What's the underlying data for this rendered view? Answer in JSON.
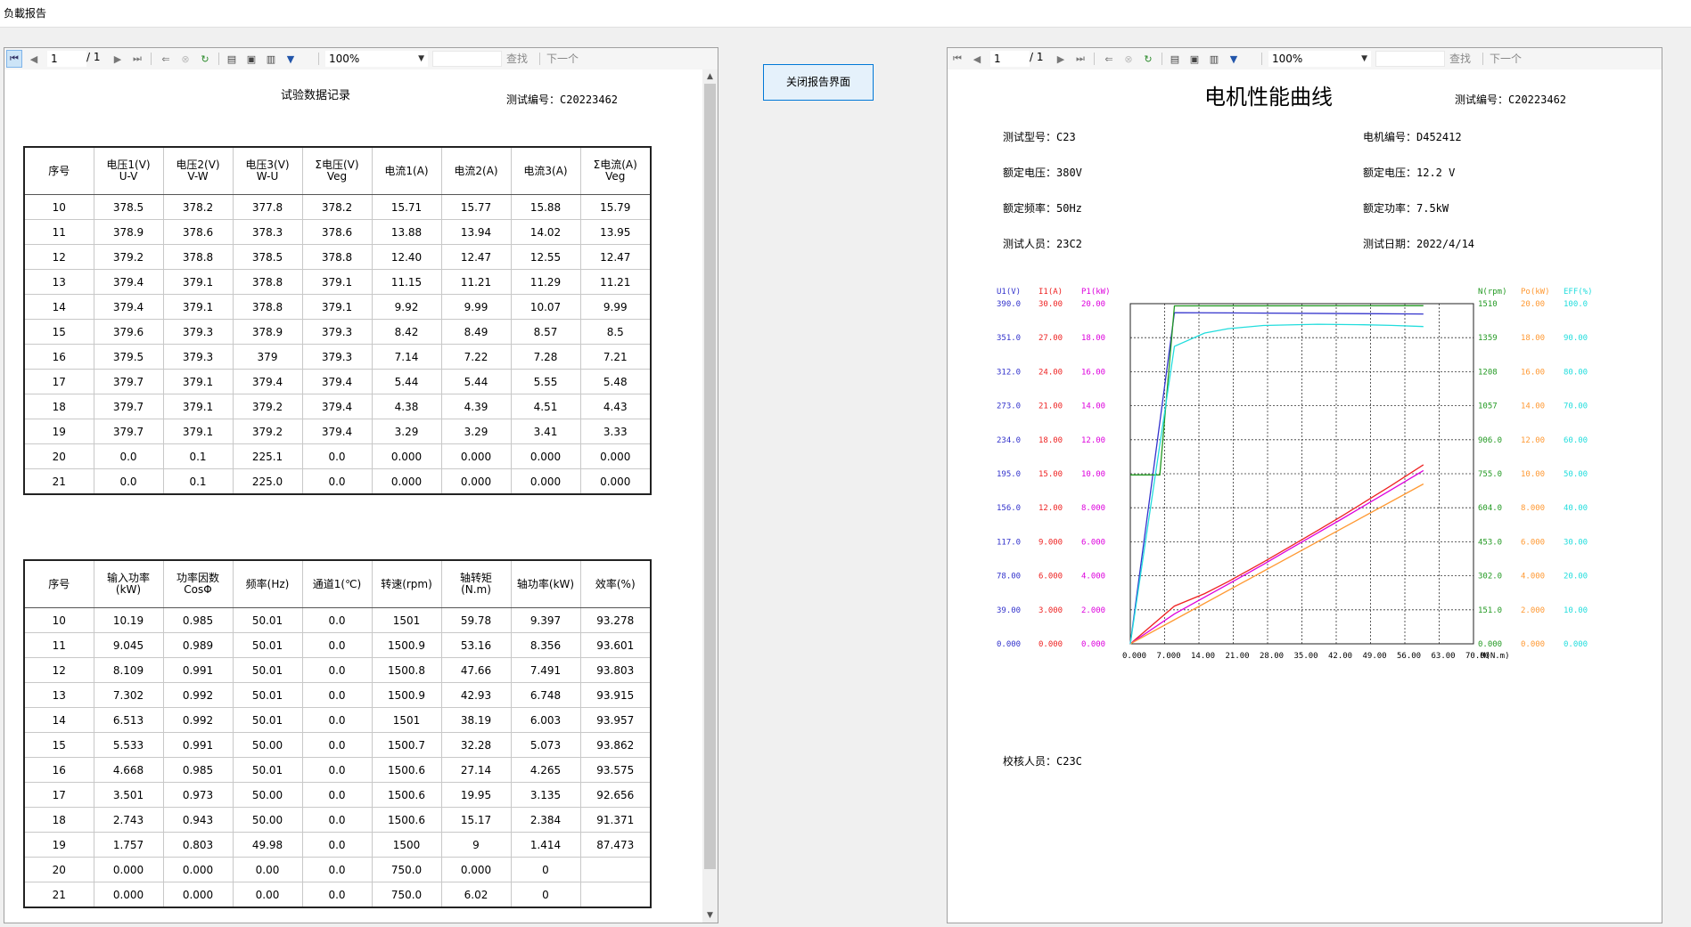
{
  "window": {
    "title": "负載报告"
  },
  "toolbar": {
    "page_current": "1",
    "page_total": "/ 1",
    "zoom": "100%",
    "find_label": "查找",
    "next_label": "下一个"
  },
  "close_button": "关闭报告界面",
  "left_report": {
    "title": "试验数据记录",
    "test_no": "测试编号：C20223462",
    "table1": {
      "headers": [
        [
          "序号",
          ""
        ],
        [
          "电压1(V)",
          "U-V"
        ],
        [
          "电压2(V)",
          "V-W"
        ],
        [
          "电压3(V)",
          "W-U"
        ],
        [
          "Σ电压(V)",
          "Veg"
        ],
        [
          "电流1(A)",
          ""
        ],
        [
          "电流2(A)",
          ""
        ],
        [
          "电流3(A)",
          ""
        ],
        [
          "Σ电流(A)",
          "Veg"
        ]
      ],
      "rows": [
        [
          "10",
          "378.5",
          "378.2",
          "377.8",
          "378.2",
          "15.71",
          "15.77",
          "15.88",
          "15.79"
        ],
        [
          "11",
          "378.9",
          "378.6",
          "378.3",
          "378.6",
          "13.88",
          "13.94",
          "14.02",
          "13.95"
        ],
        [
          "12",
          "379.2",
          "378.8",
          "378.5",
          "378.8",
          "12.40",
          "12.47",
          "12.55",
          "12.47"
        ],
        [
          "13",
          "379.4",
          "379.1",
          "378.8",
          "379.1",
          "11.15",
          "11.21",
          "11.29",
          "11.21"
        ],
        [
          "14",
          "379.4",
          "379.1",
          "378.8",
          "379.1",
          "9.92",
          "9.99",
          "10.07",
          "9.99"
        ],
        [
          "15",
          "379.6",
          "379.3",
          "378.9",
          "379.3",
          "8.42",
          "8.49",
          "8.57",
          "8.5"
        ],
        [
          "16",
          "379.5",
          "379.3",
          "379",
          "379.3",
          "7.14",
          "7.22",
          "7.28",
          "7.21"
        ],
        [
          "17",
          "379.7",
          "379.1",
          "379.4",
          "379.4",
          "5.44",
          "5.44",
          "5.55",
          "5.48"
        ],
        [
          "18",
          "379.7",
          "379.1",
          "379.2",
          "379.4",
          "4.38",
          "4.39",
          "4.51",
          "4.43"
        ],
        [
          "19",
          "379.7",
          "379.1",
          "379.2",
          "379.4",
          "3.29",
          "3.29",
          "3.41",
          "3.33"
        ],
        [
          "20",
          "0.0",
          "0.1",
          "225.1",
          "0.0",
          "0.000",
          "0.000",
          "0.000",
          "0.000"
        ],
        [
          "21",
          "0.0",
          "0.1",
          "225.0",
          "0.0",
          "0.000",
          "0.000",
          "0.000",
          "0.000"
        ]
      ]
    },
    "table2": {
      "headers": [
        [
          "序号",
          ""
        ],
        [
          "输入功率",
          "(kW)"
        ],
        [
          "功率因数",
          "CosΦ"
        ],
        [
          "频率(Hz)",
          ""
        ],
        [
          "通道1(℃)",
          ""
        ],
        [
          "转速(rpm)",
          ""
        ],
        [
          "轴转矩",
          "(N.m)"
        ],
        [
          "轴功率(kW)",
          ""
        ],
        [
          "效率(%)",
          ""
        ]
      ],
      "rows": [
        [
          "10",
          "10.19",
          "0.985",
          "50.01",
          "0.0",
          "1501",
          "59.78",
          "9.397",
          "93.278"
        ],
        [
          "11",
          "9.045",
          "0.989",
          "50.01",
          "0.0",
          "1500.9",
          "53.16",
          "8.356",
          "93.601"
        ],
        [
          "12",
          "8.109",
          "0.991",
          "50.01",
          "0.0",
          "1500.8",
          "47.66",
          "7.491",
          "93.803"
        ],
        [
          "13",
          "7.302",
          "0.992",
          "50.01",
          "0.0",
          "1500.9",
          "42.93",
          "6.748",
          "93.915"
        ],
        [
          "14",
          "6.513",
          "0.992",
          "50.01",
          "0.0",
          "1501",
          "38.19",
          "6.003",
          "93.957"
        ],
        [
          "15",
          "5.533",
          "0.991",
          "50.00",
          "0.0",
          "1500.7",
          "32.28",
          "5.073",
          "93.862"
        ],
        [
          "16",
          "4.668",
          "0.985",
          "50.01",
          "0.0",
          "1500.6",
          "27.14",
          "4.265",
          "93.575"
        ],
        [
          "17",
          "3.501",
          "0.973",
          "50.00",
          "0.0",
          "1500.6",
          "19.95",
          "3.135",
          "92.656"
        ],
        [
          "18",
          "2.743",
          "0.943",
          "50.00",
          "0.0",
          "1500.6",
          "15.17",
          "2.384",
          "91.371"
        ],
        [
          "19",
          "1.757",
          "0.803",
          "49.98",
          "0.0",
          "1500",
          "9",
          "1.414",
          "87.473"
        ],
        [
          "20",
          "0.000",
          "0.000",
          "0.00",
          "0.0",
          "750.0",
          "0.000",
          "0",
          ""
        ],
        [
          "21",
          "0.000",
          "0.000",
          "0.00",
          "0.0",
          "750.0",
          "6.02",
          "0",
          ""
        ]
      ]
    }
  },
  "right_report": {
    "title": "电机性能曲线",
    "test_no": "测试编号：C20223462",
    "info_left": [
      "测试型号：C23",
      "额定电压：380V",
      "额定频率：50Hz",
      "测试人员：23C2"
    ],
    "info_right": [
      "电机编号：D452412",
      "额定电压：12.2 V",
      "额定功率：7.5kW",
      "测试日期：2022/4/14"
    ],
    "checker": "校核人员：C23C"
  },
  "chart_data": {
    "type": "line",
    "x_label": "M(N.m)",
    "x_ticks": [
      "0.000",
      "7.000",
      "14.00",
      "21.00",
      "28.00",
      "35.00",
      "42.00",
      "49.00",
      "56.00",
      "63.00",
      "70.00"
    ],
    "xlim": [
      0,
      70
    ],
    "grid": true,
    "axes": [
      {
        "label": "U1(V)",
        "color": "#3333cc",
        "ticks": [
          "0.000",
          "39.00",
          "78.00",
          "117.0",
          "156.0",
          "195.0",
          "234.0",
          "273.0",
          "312.0",
          "351.0",
          "390.0"
        ],
        "range": [
          0,
          390
        ]
      },
      {
        "label": "I1(A)",
        "color": "#ee2222",
        "ticks": [
          "0.000",
          "3.000",
          "6.000",
          "9.000",
          "12.00",
          "15.00",
          "18.00",
          "21.00",
          "24.00",
          "27.00",
          "30.00"
        ],
        "range": [
          0,
          30
        ]
      },
      {
        "label": "P1(kW)",
        "color": "#dd00dd",
        "ticks": [
          "0.000",
          "2.000",
          "4.000",
          "6.000",
          "8.000",
          "10.00",
          "12.00",
          "14.00",
          "16.00",
          "18.00",
          "20.00"
        ],
        "range": [
          0,
          20
        ]
      },
      {
        "label": "N(rpm)",
        "color": "#229922",
        "ticks": [
          "0.000",
          "151.0",
          "302.0",
          "453.0",
          "604.0",
          "755.0",
          "906.0",
          "1057",
          "1208",
          "1359",
          "1510"
        ],
        "range": [
          0,
          1510
        ]
      },
      {
        "label": "Po(kW)",
        "color": "#ff9933",
        "ticks": [
          "0.000",
          "2.000",
          "4.000",
          "6.000",
          "8.000",
          "10.00",
          "12.00",
          "14.00",
          "16.00",
          "18.00",
          "20.00"
        ],
        "range": [
          0,
          20
        ]
      },
      {
        "label": "EFF(%)",
        "color": "#22dddd",
        "ticks": [
          "0.000",
          "10.00",
          "20.00",
          "30.00",
          "40.00",
          "50.00",
          "60.00",
          "70.00",
          "80.00",
          "90.00",
          "100.0"
        ],
        "range": [
          0,
          100
        ]
      }
    ],
    "series": [
      {
        "axis": 0,
        "color": "#3333cc",
        "points": [
          [
            0,
            0
          ],
          [
            9,
            379.7
          ],
          [
            20,
            379.4
          ],
          [
            59.78,
            378.2
          ]
        ]
      },
      {
        "axis": 1,
        "color": "#ee2222",
        "points": [
          [
            0,
            0
          ],
          [
            9,
            3.33
          ],
          [
            15.17,
            4.43
          ],
          [
            19.95,
            5.48
          ],
          [
            27.14,
            7.21
          ],
          [
            32.28,
            8.5
          ],
          [
            38.19,
            9.99
          ],
          [
            42.93,
            11.21
          ],
          [
            47.66,
            12.47
          ],
          [
            53.16,
            13.95
          ],
          [
            59.78,
            15.79
          ]
        ]
      },
      {
        "axis": 2,
        "color": "#dd00dd",
        "points": [
          [
            0,
            0
          ],
          [
            9,
            1.757
          ],
          [
            15.17,
            2.743
          ],
          [
            19.95,
            3.501
          ],
          [
            27.14,
            4.668
          ],
          [
            32.28,
            5.533
          ],
          [
            38.19,
            6.513
          ],
          [
            42.93,
            7.302
          ],
          [
            47.66,
            8.109
          ],
          [
            53.16,
            9.045
          ],
          [
            59.78,
            10.19
          ]
        ]
      },
      {
        "axis": 3,
        "color": "#229922",
        "points": [
          [
            0,
            750
          ],
          [
            6.02,
            750
          ],
          [
            9,
            1500
          ],
          [
            59.78,
            1501
          ]
        ]
      },
      {
        "axis": 4,
        "color": "#ff9933",
        "points": [
          [
            0,
            0
          ],
          [
            9,
            1.414
          ],
          [
            27.14,
            4.265
          ],
          [
            59.78,
            9.397
          ]
        ]
      },
      {
        "axis": 5,
        "color": "#22dddd",
        "points": [
          [
            0,
            0
          ],
          [
            9,
            87.473
          ],
          [
            15.17,
            91.371
          ],
          [
            19.95,
            92.656
          ],
          [
            27.14,
            93.575
          ],
          [
            38.19,
            93.957
          ],
          [
            47.66,
            93.803
          ],
          [
            53.16,
            93.601
          ],
          [
            59.78,
            93.278
          ]
        ]
      }
    ]
  }
}
